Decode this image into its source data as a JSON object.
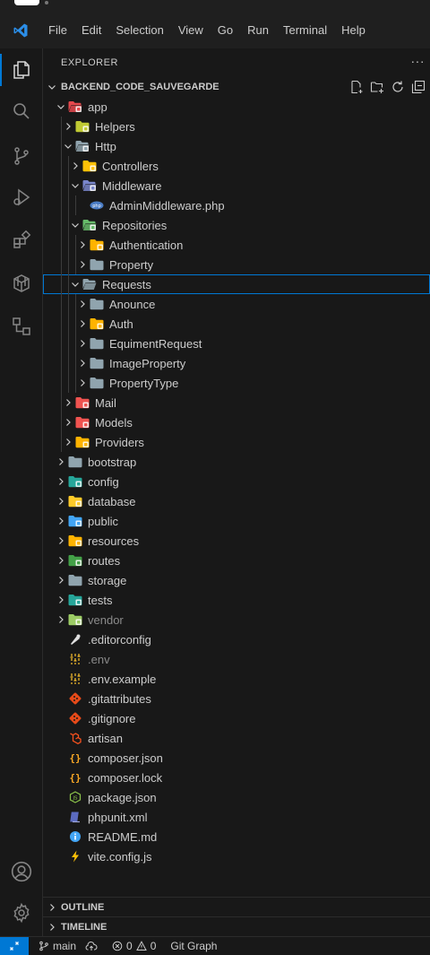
{
  "menu": [
    "File",
    "Edit",
    "Selection",
    "View",
    "Go",
    "Run",
    "Terminal",
    "Help"
  ],
  "explorer": {
    "title": "EXPLORER",
    "more": "···",
    "project": "BACKEND_CODE_SAUVEGARDE"
  },
  "tree": [
    {
      "label": "app",
      "depth": 0,
      "expanded": true,
      "folder": true,
      "icon": "folder-app",
      "color": "#e5484d"
    },
    {
      "label": "Helpers",
      "depth": 1,
      "expanded": false,
      "folder": true,
      "icon": "folder-helper",
      "color": "#c0ca33"
    },
    {
      "label": "Http",
      "depth": 1,
      "expanded": true,
      "folder": true,
      "icon": "folder-http",
      "color": "#90a4ae"
    },
    {
      "label": "Controllers",
      "depth": 2,
      "expanded": false,
      "folder": true,
      "icon": "folder-controller",
      "color": "#ffc107"
    },
    {
      "label": "Middleware",
      "depth": 2,
      "expanded": true,
      "folder": true,
      "icon": "folder-middleware",
      "color": "#7986cb"
    },
    {
      "label": "AdminMiddleware.php",
      "depth": 3,
      "folder": false,
      "icon": "php-file",
      "color": "#4a7cc4"
    },
    {
      "label": "Repositories",
      "depth": 2,
      "expanded": true,
      "folder": true,
      "icon": "folder-repository",
      "color": "#66bb6a"
    },
    {
      "label": "Authentication",
      "depth": 3,
      "expanded": false,
      "folder": true,
      "icon": "folder-auth",
      "color": "#ffb300"
    },
    {
      "label": "Property",
      "depth": 3,
      "expanded": false,
      "folder": true,
      "icon": "folder",
      "color": "#90a4ae"
    },
    {
      "label": "Requests",
      "depth": 2,
      "expanded": true,
      "folder": true,
      "icon": "folder-open",
      "color": "#90a4ae",
      "selected": true
    },
    {
      "label": "Anounce",
      "depth": 3,
      "expanded": false,
      "folder": true,
      "icon": "folder",
      "color": "#90a4ae"
    },
    {
      "label": "Auth",
      "depth": 3,
      "expanded": false,
      "folder": true,
      "icon": "folder-auth",
      "color": "#ffb300"
    },
    {
      "label": "EquimentRequest",
      "depth": 3,
      "expanded": false,
      "folder": true,
      "icon": "folder",
      "color": "#90a4ae"
    },
    {
      "label": "ImageProperty",
      "depth": 3,
      "expanded": false,
      "folder": true,
      "icon": "folder",
      "color": "#90a4ae"
    },
    {
      "label": "PropertyType",
      "depth": 3,
      "expanded": false,
      "folder": true,
      "icon": "folder",
      "color": "#90a4ae"
    },
    {
      "label": "Mail",
      "depth": 1,
      "expanded": false,
      "folder": true,
      "icon": "folder-mail",
      "color": "#ef5350"
    },
    {
      "label": "Models",
      "depth": 1,
      "expanded": false,
      "folder": true,
      "icon": "folder-models",
      "color": "#ef5350"
    },
    {
      "label": "Providers",
      "depth": 1,
      "expanded": false,
      "folder": true,
      "icon": "folder-providers",
      "color": "#ffb300"
    },
    {
      "label": "bootstrap",
      "depth": 0,
      "expanded": false,
      "folder": true,
      "icon": "folder",
      "color": "#90a4ae"
    },
    {
      "label": "config",
      "depth": 0,
      "expanded": false,
      "folder": true,
      "icon": "folder-config",
      "color": "#26a69a"
    },
    {
      "label": "database",
      "depth": 0,
      "expanded": false,
      "folder": true,
      "icon": "folder-database",
      "color": "#ffca28"
    },
    {
      "label": "public",
      "depth": 0,
      "expanded": false,
      "folder": true,
      "icon": "folder-public",
      "color": "#42a5f5"
    },
    {
      "label": "resources",
      "depth": 0,
      "expanded": false,
      "folder": true,
      "icon": "folder-resources",
      "color": "#ffb300"
    },
    {
      "label": "routes",
      "depth": 0,
      "expanded": false,
      "folder": true,
      "icon": "folder-routes",
      "color": "#43a047"
    },
    {
      "label": "storage",
      "depth": 0,
      "expanded": false,
      "folder": true,
      "icon": "folder",
      "color": "#90a4ae"
    },
    {
      "label": "tests",
      "depth": 0,
      "expanded": false,
      "folder": true,
      "icon": "folder-test",
      "color": "#26a69a"
    },
    {
      "label": "vendor",
      "depth": 0,
      "expanded": false,
      "folder": true,
      "icon": "folder-vendor",
      "color": "#9ccc65",
      "dim": true
    },
    {
      "label": ".editorconfig",
      "depth": 0,
      "folder": false,
      "icon": "editorconfig-file",
      "color": "#e0e0e0"
    },
    {
      "label": ".env",
      "depth": 0,
      "folder": false,
      "icon": "env-file",
      "color": "#fbc02d",
      "dim": true
    },
    {
      "label": ".env.example",
      "depth": 0,
      "folder": false,
      "icon": "env-file",
      "color": "#fbc02d"
    },
    {
      "label": ".gitattributes",
      "depth": 0,
      "folder": false,
      "icon": "git-file",
      "color": "#e64a19"
    },
    {
      "label": ".gitignore",
      "depth": 0,
      "folder": false,
      "icon": "git-file",
      "color": "#e64a19"
    },
    {
      "label": "artisan",
      "depth": 0,
      "folder": false,
      "icon": "laravel-file",
      "color": "#f4511e"
    },
    {
      "label": "composer.json",
      "depth": 0,
      "folder": false,
      "icon": "json-file",
      "color": "#f9a825"
    },
    {
      "label": "composer.lock",
      "depth": 0,
      "folder": false,
      "icon": "json-file",
      "color": "#f9a825"
    },
    {
      "label": "package.json",
      "depth": 0,
      "folder": false,
      "icon": "nodejs-file",
      "color": "#8bc34a"
    },
    {
      "label": "phpunit.xml",
      "depth": 0,
      "folder": false,
      "icon": "phpunit-file",
      "color": "#5c6bc0"
    },
    {
      "label": "README.md",
      "depth": 0,
      "folder": false,
      "icon": "info-file",
      "color": "#42a5f5"
    },
    {
      "label": "vite.config.js",
      "depth": 0,
      "folder": false,
      "icon": "vite-file",
      "color": "#ffc107"
    }
  ],
  "sections": {
    "outline": "OUTLINE",
    "timeline": "TIMELINE"
  },
  "status": {
    "branch": "main",
    "errors": "0",
    "warnings": "0",
    "git_graph": "Git Graph"
  },
  "colors": {
    "accent": "#0078d4",
    "background": "#181818"
  }
}
